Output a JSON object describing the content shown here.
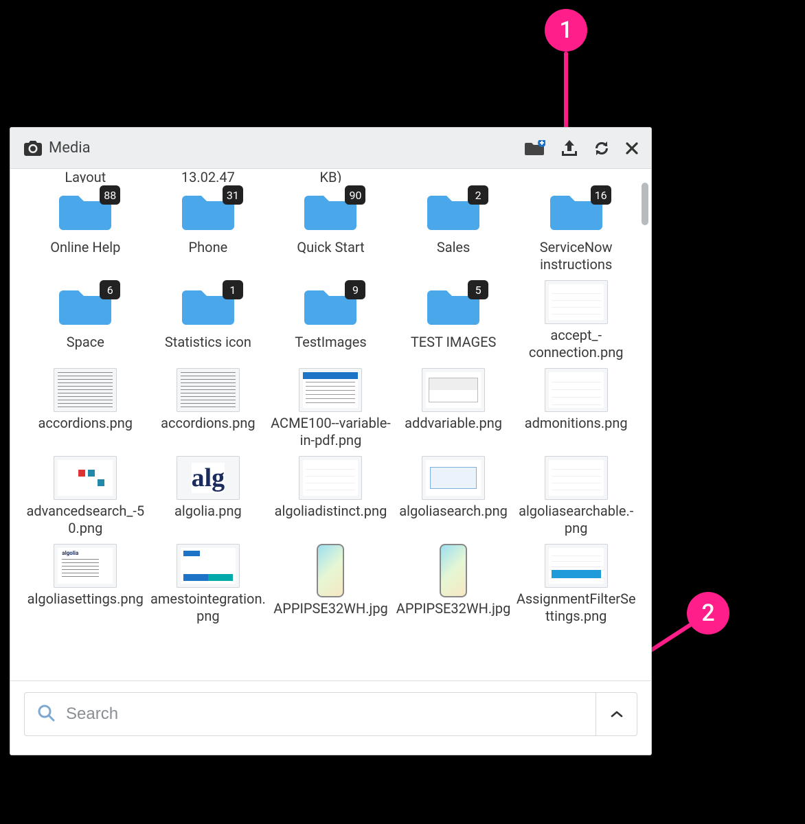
{
  "header": {
    "title": "Media"
  },
  "partial_row": [
    "Layout",
    "13.02.47",
    "KB)",
    "",
    ""
  ],
  "folders": [
    {
      "name": "Online Help",
      "count": "88"
    },
    {
      "name": "Phone",
      "count": "31"
    },
    {
      "name": "Quick Start",
      "count": "90"
    },
    {
      "name": "Sales",
      "count": "2"
    },
    {
      "name": "ServiceNow instructions",
      "count": "16"
    },
    {
      "name": "Space",
      "count": "6"
    },
    {
      "name": "Statistics icon",
      "count": "1"
    },
    {
      "name": "TestImages",
      "count": "9"
    },
    {
      "name": "TEST IMAGES",
      "count": "5"
    }
  ],
  "files": [
    {
      "name": "accept_-connection.png",
      "thumb": "list"
    },
    {
      "name": "accordions.png",
      "thumb": "text"
    },
    {
      "name": "accordions.png",
      "thumb": "text"
    },
    {
      "name": "ACME100--variable-in-pdf.png",
      "thumb": "bluebar"
    },
    {
      "name": "addvariable.png",
      "thumb": "table"
    },
    {
      "name": "admonitions.png",
      "thumb": "listR"
    },
    {
      "name": "advancedsearch_-50.png",
      "thumb": "dots"
    },
    {
      "name": "algolia.png",
      "thumb": "alg"
    },
    {
      "name": "algoliadistinct.png",
      "thumb": "list"
    },
    {
      "name": "algoliasearch.png",
      "thumb": "box"
    },
    {
      "name": "algoliasearchable.-png",
      "thumb": "list"
    },
    {
      "name": "algoliasettings.png",
      "thumb": "settings"
    },
    {
      "name": "amestointegration.png",
      "thumb": "form"
    },
    {
      "name": "APPIPSE32WH.jpg",
      "thumb": "phone"
    },
    {
      "name": "APPIPSE32WH.jpg",
      "thumb": "phone"
    },
    {
      "name": "AssignmentFilterSettings.png",
      "thumb": "assign"
    }
  ],
  "search": {
    "placeholder": "Search"
  },
  "callouts": {
    "one": "1",
    "two": "2"
  }
}
